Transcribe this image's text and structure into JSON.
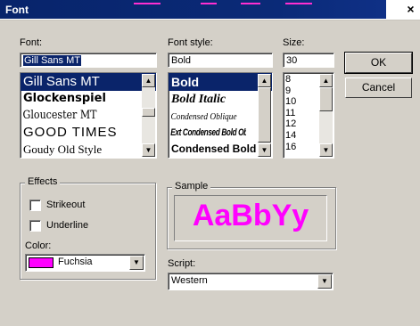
{
  "window": {
    "title": "Font",
    "close_glyph": "×"
  },
  "font": {
    "label": "Font:",
    "value": "Gill Sans MT",
    "items": [
      "Gill Sans MT",
      "Glockenspiel",
      "Gloucester MT",
      "GOOD TIMES",
      "Goudy Old Style"
    ]
  },
  "style": {
    "label": "Font style:",
    "value": "Bold",
    "items": [
      "Bold",
      "Bold Italic",
      "Condensed Oblique",
      "Ext Condensed Bold Oblique",
      "Condensed Bold"
    ]
  },
  "size": {
    "label": "Size:",
    "value": "30",
    "items": [
      "8",
      "9",
      "10",
      "11",
      "12",
      "14",
      "16"
    ]
  },
  "buttons": {
    "ok": "OK",
    "cancel": "Cancel"
  },
  "effects": {
    "title": "Effects",
    "strikeout": "Strikeout",
    "underline": "Underline",
    "color_label": "Color:",
    "color_value": "Fuchsia",
    "color_hex": "#ff00ff"
  },
  "sample": {
    "title": "Sample",
    "text": "AaBbYy"
  },
  "script": {
    "label": "Script:",
    "value": "Western"
  }
}
